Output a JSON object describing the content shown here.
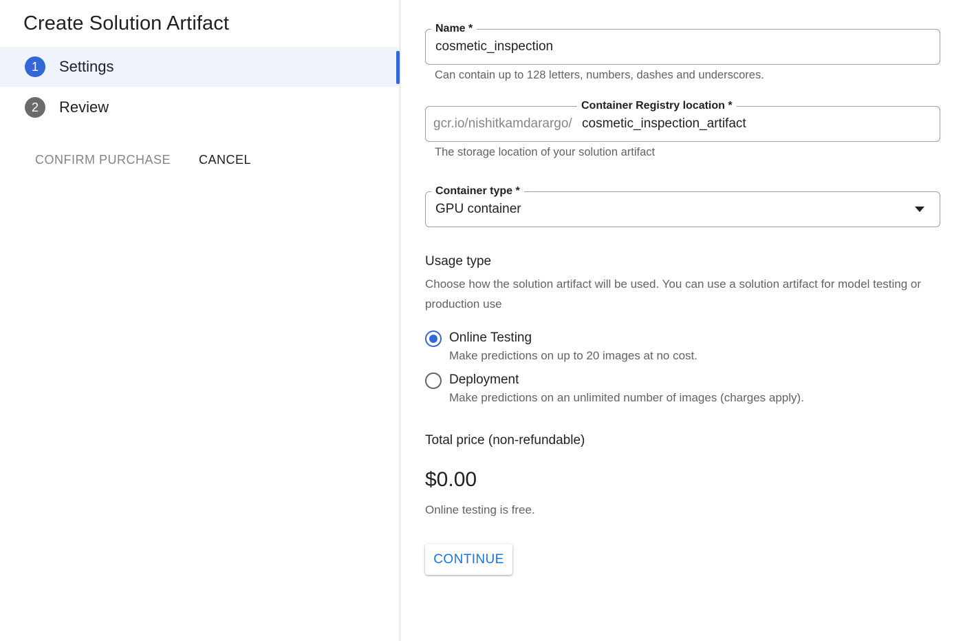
{
  "panel": {
    "title": "Create Solution Artifact",
    "steps": [
      {
        "number": "1",
        "label": "Settings",
        "active": true
      },
      {
        "number": "2",
        "label": "Review",
        "active": false
      }
    ],
    "confirm_label": "CONFIRM PURCHASE",
    "cancel_label": "CANCEL"
  },
  "form": {
    "name": {
      "label": "Name *",
      "value": "cosmetic_inspection",
      "helper": "Can contain up to 128 letters, numbers, dashes and underscores."
    },
    "registry": {
      "label": "Container Registry location *",
      "prefix": "gcr.io/nishitkamdarargo/",
      "value": "cosmetic_inspection_artifact",
      "helper": "The storage location of your solution artifact"
    },
    "container_type": {
      "label": "Container type *",
      "value": "GPU container"
    },
    "usage": {
      "title": "Usage type",
      "description": "Choose how the solution artifact will be used. You can use a solution artifact for model testing or production use",
      "options": [
        {
          "label": "Online Testing",
          "description": "Make predictions on up to 20 images at no cost.",
          "selected": true
        },
        {
          "label": "Deployment",
          "description": "Make predictions on an unlimited number of images (charges apply).",
          "selected": false
        }
      ]
    },
    "price": {
      "label": "Total price (non-refundable)",
      "value": "$0.00",
      "note": "Online testing is free."
    },
    "continue_label": "CONTINUE"
  },
  "colors": {
    "accent": "#3367d6",
    "active_step_bg": "#eef3fc",
    "continue_text": "#1a73e8",
    "muted_text": "#5f6368"
  }
}
